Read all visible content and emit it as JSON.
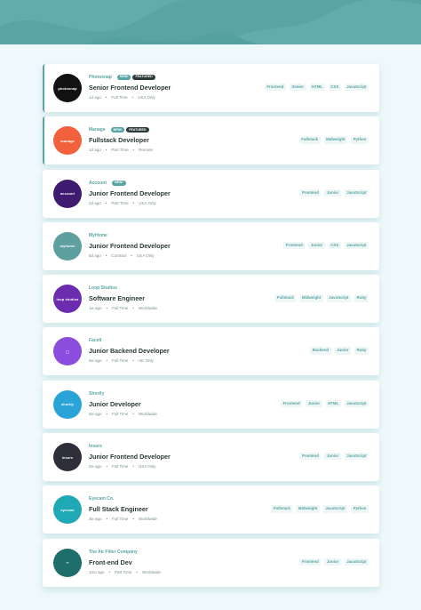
{
  "colors": {
    "accent": "#5ba4a4",
    "dark": "#2c3a3a",
    "background": "#eff9fb",
    "tag_background": "#eef6f6"
  },
  "jobs": [
    {
      "company": "Photosnap",
      "logo_text": "PHOTOSNAP",
      "logo_color": "#121212",
      "new_label": "NEW!",
      "featured_label": "FEATURED",
      "position": "Senior Frontend Developer",
      "posted": "1d ago",
      "contract": "Full Time",
      "location": "USA Only",
      "tags": [
        "Frontend",
        "Senior",
        "HTML",
        "CSS",
        "JavaScript"
      ]
    },
    {
      "company": "Manage",
      "logo_text": "manage",
      "logo_color": "#f0613c",
      "new_label": "NEW!",
      "featured_label": "FEATURED",
      "position": "Fullstack Developer",
      "posted": "1d ago",
      "contract": "Part Time",
      "location": "Remote",
      "tags": [
        "Fullstack",
        "Midweight",
        "Python"
      ]
    },
    {
      "company": "Account",
      "logo_text": "ACCOUNT",
      "logo_color": "#3e1b6f",
      "new_label": "NEW!",
      "position": "Junior Frontend Developer",
      "posted": "2d ago",
      "contract": "Part Time",
      "location": "USA Only",
      "tags": [
        "Frontend",
        "Junior",
        "JavaScript"
      ]
    },
    {
      "company": "MyHome",
      "logo_text": "MYHOME",
      "logo_color": "#5e9f9f",
      "position": "Junior Frontend Developer",
      "posted": "5d ago",
      "contract": "Contract",
      "location": "USA Only",
      "tags": [
        "Frontend",
        "Junior",
        "CSS",
        "JavaScript"
      ]
    },
    {
      "company": "Loop Studios",
      "logo_text": "loop studios",
      "logo_color": "#6b2dad",
      "position": "Software Engineer",
      "posted": "1w ago",
      "contract": "Full Time",
      "location": "Worldwide",
      "tags": [
        "Fullstack",
        "Midweight",
        "JavaScript",
        "Ruby"
      ]
    },
    {
      "company": "FaceIt",
      "logo_text": "◯",
      "logo_color": "#8a4dde",
      "position": "Junior Backend Developer",
      "posted": "2w ago",
      "contract": "Full Time",
      "location": "UK Only",
      "tags": [
        "Backend",
        "Junior",
        "Ruby"
      ]
    },
    {
      "company": "Shortly",
      "logo_text": "shortly",
      "logo_color": "#2aa4d6",
      "position": "Junior Developer",
      "posted": "2w ago",
      "contract": "Full Time",
      "location": "Worldwide",
      "tags": [
        "Frontend",
        "Junior",
        "HTML",
        "JavaScript"
      ]
    },
    {
      "company": "Insure",
      "logo_text": "INSURE",
      "logo_color": "#2f2f3b",
      "position": "Junior Frontend Developer",
      "posted": "2w ago",
      "contract": "Full Time",
      "location": "USA Only",
      "tags": [
        "Frontend",
        "Junior",
        "JavaScript"
      ]
    },
    {
      "company": "Eyecam Co.",
      "logo_text": "EYECAM",
      "logo_color": "#1fa9b5",
      "position": "Full Stack Engineer",
      "posted": "3w ago",
      "contract": "Full Time",
      "location": "Worldwide",
      "tags": [
        "Fullstack",
        "Midweight",
        "JavaScript",
        "Python"
      ]
    },
    {
      "company": "The Air Filter Company",
      "logo_text": "∞",
      "logo_color": "#1e6f6b",
      "position": "Front-end Dev",
      "posted": "1mo ago",
      "contract": "Part Time",
      "location": "Worldwide",
      "tags": [
        "Frontend",
        "Junior",
        "JavaScript"
      ]
    }
  ]
}
